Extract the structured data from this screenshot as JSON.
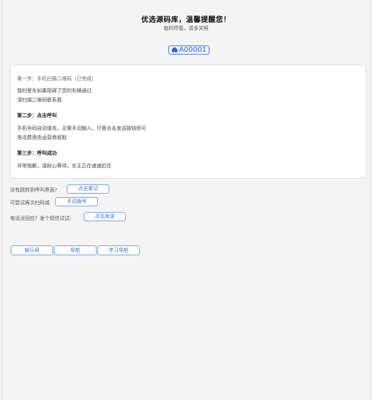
{
  "header": {
    "title": "优选源码库，温馨提醒您！",
    "subtitle": "临时停靠，请多关照"
  },
  "badge": {
    "icon": "car-icon",
    "code": "A00001"
  },
  "steps": {
    "step1_title": "第一步：手机扫描二维码（已完成）",
    "step1_line1": "我的爱车如果阻碍了您的车辆通过",
    "step1_line2": "请扫描二维码联系我",
    "step2_title": "第二步：点击呼叫",
    "step2_line1": "手机号码自动填充，无需手动输入，只需点击发送按钮即可",
    "step2_line2": "电话费用由运营商收取",
    "step3_title": "第三步：呼叫成功",
    "step3_line1": "非常抱歉，请耐心等待，车主正在速速赶往"
  },
  "actions": {
    "retry_text": "没有跳转到呼叫界面?",
    "retry_button": "点击重试",
    "manual_text": "可尝试再次扫码或",
    "manual_button": "手动拨号",
    "sms_text": "电话没回应？发个短信试试:",
    "sms_button": "点击发送"
  },
  "nav": {
    "items": [
      "娱乐网",
      "导航",
      "学习导航"
    ]
  },
  "colors": {
    "accent": "#3f74d4",
    "border": "#7aa3e6",
    "background": "#f4f4f5"
  }
}
